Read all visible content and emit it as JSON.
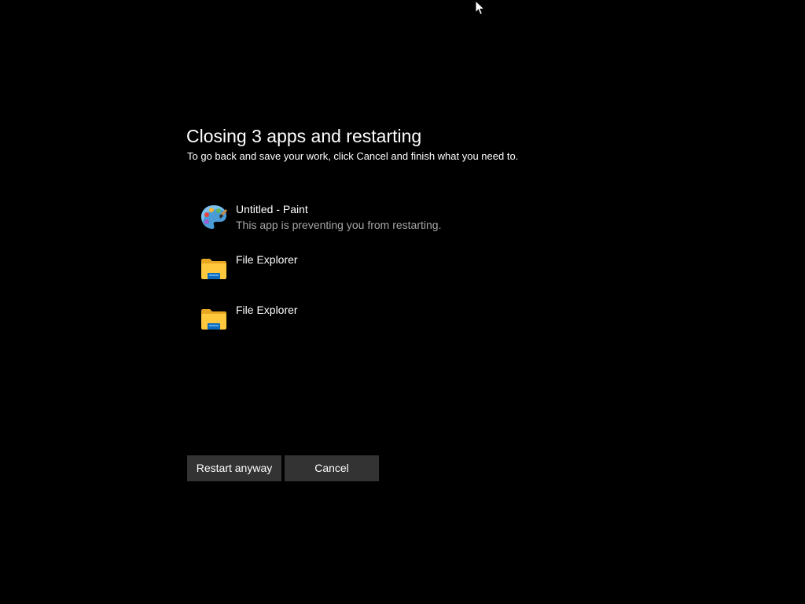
{
  "dialog": {
    "title": "Closing 3 apps and restarting",
    "subtitle": "To go back and save your work, click Cancel and finish what you need to."
  },
  "apps": [
    {
      "name": "Untitled - Paint",
      "status": "This app is preventing you from restarting.",
      "icon": "paint-palette-icon"
    },
    {
      "name": "File Explorer",
      "status": "",
      "icon": "folder-icon"
    },
    {
      "name": "File Explorer",
      "status": "",
      "icon": "folder-icon"
    }
  ],
  "buttons": {
    "restart_label": "Restart anyway",
    "cancel_label": "Cancel"
  },
  "colors": {
    "background": "#000000",
    "text": "#ffffff",
    "secondary_text": "#a6a6a6",
    "button_bg": "#333333",
    "folder_yellow": "#ffc83d",
    "folder_blue": "#0f6cbd"
  }
}
